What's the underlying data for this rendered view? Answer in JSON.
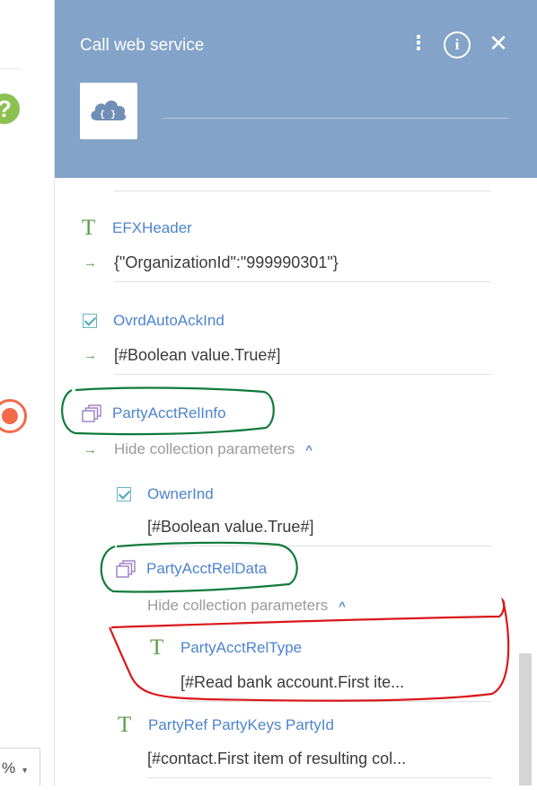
{
  "left_panel": {
    "zoom_value": "%",
    "help_icon_glyph": "?"
  },
  "panel": {
    "title": "Call web service",
    "kebab_glyph": "⋮",
    "info_glyph": "i",
    "close_glyph": "✕",
    "icon": "cloud-code-icon"
  },
  "params": [
    {
      "type": "text",
      "name": "EFXHeader",
      "value": "{\"OrganizationId\":\"999990301\"}"
    },
    {
      "type": "boolean",
      "name": "OvrdAutoAckInd",
      "value": "[#Boolean value.True#]"
    },
    {
      "type": "collection",
      "name": "PartyAcctRelInfo",
      "toggle": "Hide collection parameters",
      "children": [
        {
          "type": "boolean",
          "name": "OwnerInd",
          "value": "[#Boolean value.True#]"
        },
        {
          "type": "collection",
          "name": "PartyAcctRelData",
          "toggle": "Hide collection parameters",
          "children": [
            {
              "type": "text",
              "name": "PartyAcctRelType",
              "value": "[#Read bank account.First ite..."
            }
          ]
        },
        {
          "type": "text",
          "name": "PartyRef PartyKeys PartyId",
          "value": "[#contact.First item of resulting col..."
        }
      ]
    }
  ],
  "icons": {
    "text_type": "T",
    "arrow": "→",
    "caret_up": "^",
    "zoom_caret": "▼"
  },
  "colors": {
    "header": "#83a3c8",
    "link": "#4d84cc",
    "accent_green": "#5b9e45",
    "annotation_green": "#117a3c",
    "annotation_red": "#d9171b"
  }
}
